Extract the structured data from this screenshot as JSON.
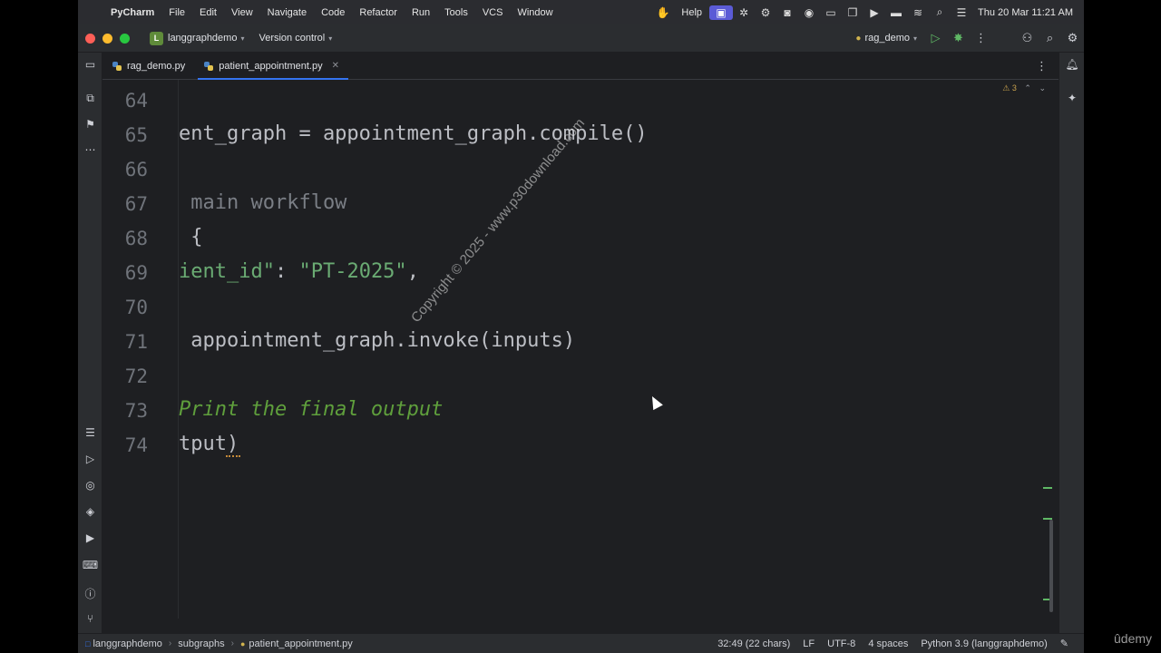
{
  "menubar": {
    "app_name": "PyCharm",
    "items": [
      "File",
      "Edit",
      "View",
      "Navigate",
      "Code",
      "Refactor",
      "Run",
      "Tools",
      "VCS",
      "Window"
    ],
    "help": "Help",
    "clock": "Thu 20 Mar  11:21 AM"
  },
  "titlebar": {
    "project_badge": "L",
    "project_name": "langgraphdemo",
    "vcs_label": "Version control",
    "run_config": "rag_demo"
  },
  "tabs": [
    {
      "label": "rag_demo.py"
    },
    {
      "label": "patient_appointment.py"
    }
  ],
  "editor": {
    "warning_count": "3",
    "line_numbers": [
      "64",
      "65",
      "66",
      "67",
      "68",
      "69",
      "70",
      "71",
      "72",
      "73",
      "74"
    ],
    "lines": {
      "l65": "ent_graph = appointment_graph.compile()",
      "l67": " main workflow",
      "l68": " {",
      "l69_key": "ient_id\"",
      "l69_sep": ": ",
      "l69_val": "\"PT-2025\"",
      "l69_end": ",",
      "l71": " appointment_graph.invoke(inputs)",
      "l73": "Print the final output",
      "l74": "tput)"
    }
  },
  "watermark": "Copyright © 2025 - www.p30download.com",
  "statusbar": {
    "breadcrumbs": [
      "langgraphdemo",
      "subgraphs",
      "patient_appointment.py"
    ],
    "position": "32:49 (22 chars)",
    "line_sep": "LF",
    "encoding": "UTF-8",
    "indent": "4 spaces",
    "interpreter": "Python 3.9 (langgraphdemo)"
  },
  "overlay": {
    "brand": "ûdemy"
  }
}
